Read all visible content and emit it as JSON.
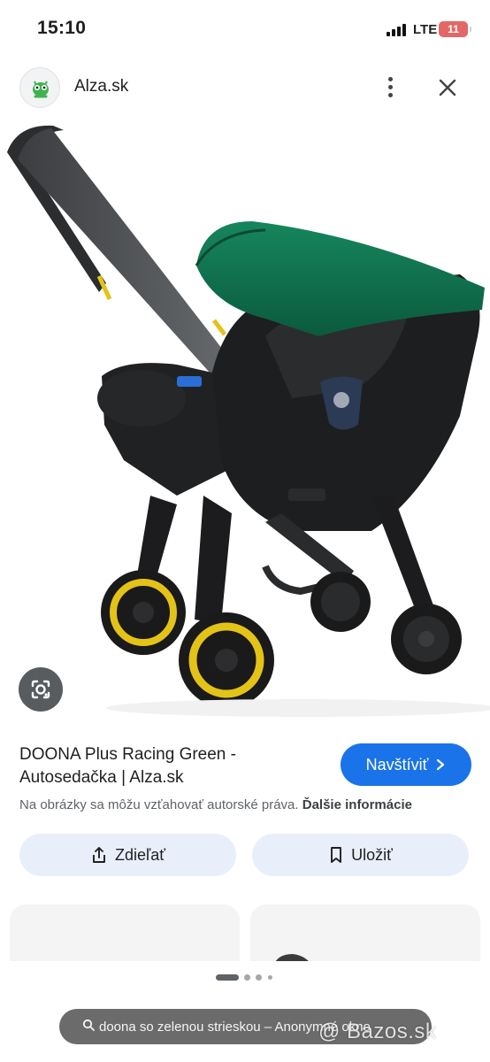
{
  "status_bar": {
    "time": "15:10",
    "network": "LTE",
    "battery": "11"
  },
  "header": {
    "site_name": "Alza.sk",
    "favicon_icon": "alza-alien-mascot-icon",
    "more_icon": "more-vertical-icon",
    "close_icon": "close-icon"
  },
  "result": {
    "title": "DOONA Plus Racing Green - Autosedačka | Alza.sk",
    "visit_label": "Navštíviť",
    "copyright_text": "Na obrázky sa môžu vzťahovať autorské práva.",
    "more_info_label": "Ďalšie informácie",
    "share_label": "Zdieľať",
    "save_label": "Uložiť"
  },
  "browser": {
    "url_text": "doona so zelenou strieskou – Anonymné okno",
    "watermark": "@ Bazos.sk"
  },
  "colors": {
    "accent": "#1a73e8",
    "pill_bg": "#e8effb",
    "canopy_green": "#0f6b4a",
    "wheel_yellow": "#e3c318"
  }
}
